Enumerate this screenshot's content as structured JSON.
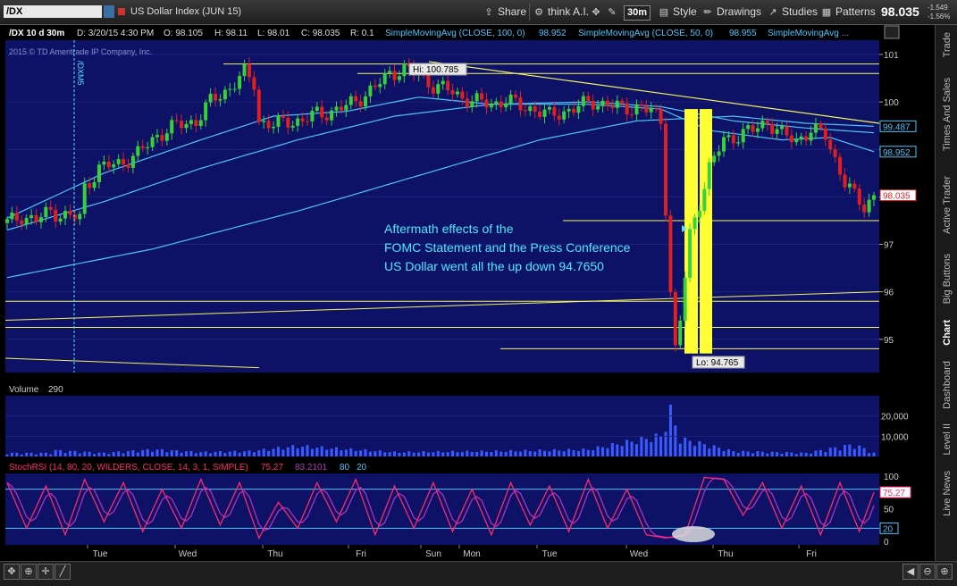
{
  "toolbar": {
    "symbol": "/DX",
    "description": "US Dollar Index (JUN 15)",
    "share": "Share",
    "think_ai": "think A.I.",
    "period": "30m",
    "style": "Style",
    "drawings": "Drawings",
    "studies": "Studies",
    "patterns": "Patterns",
    "last_price": "98.035",
    "change_abs": "-1.549",
    "change_pct": "-1.56%"
  },
  "header": {
    "symbol_period": "/DX 10 d 30m",
    "date": "D: 3/20/15 4:30 PM",
    "open": "O: 98.105",
    "high": "H: 98.11",
    "low": "L: 98.01",
    "close": "C: 98.035",
    "range": "R: 0.1",
    "sma100_label": "SimpleMovingAvg (CLOSE, 100, 0)",
    "sma100_value": "98.952",
    "sma50_label": "SimpleMovingAvg (CLOSE, 50, 0)",
    "sma50_value": "98.955",
    "sma_third_label": "SimpleMovingAvg ...",
    "copyright": "2015 © TD Ameritrade IP Company, Inc.",
    "contract_roll": "/DXM5"
  },
  "annotations": {
    "high_label": "Hi: 100.785",
    "low_label": "Lo: 94.765",
    "note_line1": "Aftermath effects of the",
    "note_line2": "FOMC Statement and the Press Conference",
    "note_line3": "US Dollar went all the up down 94.7650"
  },
  "price_badges": {
    "b1": "99.487",
    "b2": "98.952",
    "b3": "98.035"
  },
  "volume_panel": {
    "label": "Volume",
    "value": "290"
  },
  "stoch_panel": {
    "label": "StochRSI (14, 80, 20, WILDERS, CLOSE, 14, 3, 1, SIMPLE)",
    "k_value": "75.27",
    "d_value": "83.2101",
    "overbought": "80",
    "oversold": "20",
    "badge_k": "75.27",
    "badge_os": "20"
  },
  "right_tabs": [
    "Trade",
    "Times And Sales",
    "Active Trader",
    "Big Buttons",
    "Chart",
    "Dashboard",
    "Level II",
    "Live News"
  ],
  "colors": {
    "plot_bg": "#0d1266",
    "up_candle": "#39d139",
    "down_candle": "#e02020",
    "sma": "#4fc3f7",
    "trendline": "#f5f560",
    "highlight": "#ffff33",
    "note_text": "#4fe8ff",
    "volume": "#3b5bff",
    "stoch_k": "#ff2a6d",
    "stoch_d": "#b030c0"
  },
  "chart_data": {
    "type": "candlestick",
    "title": "/DX 10 d 30m",
    "x_ticks": [
      "Tue",
      "Wed",
      "Thu",
      "Fri",
      "Sun",
      "Mon",
      "Tue",
      "Wed",
      "Thu",
      "Fri"
    ],
    "y_ticks": [
      95,
      96,
      97,
      98,
      99,
      100,
      101
    ],
    "ylim": [
      94.3,
      101.3
    ],
    "volume_ticks": [
      "10,000",
      "20,000"
    ],
    "volume_ylim": [
      0,
      30000
    ],
    "stoch_ticks": [
      0,
      20,
      50,
      80,
      100
    ],
    "stoch_ylim": [
      0,
      100
    ],
    "close_path": [
      [
        0,
        97.45
      ],
      [
        3,
        97.6
      ],
      [
        6,
        97.5
      ],
      [
        9,
        97.7
      ],
      [
        12,
        97.6
      ],
      [
        15,
        97.55
      ],
      [
        16,
        98.2
      ],
      [
        19,
        98.6
      ],
      [
        23,
        98.7
      ],
      [
        27,
        98.9
      ],
      [
        31,
        99.3
      ],
      [
        35,
        99.5
      ],
      [
        39,
        99.6
      ],
      [
        42,
        100.0
      ],
      [
        46,
        100.3
      ],
      [
        49,
        100.6
      ],
      [
        51,
        100.4
      ],
      [
        52,
        99.6
      ],
      [
        55,
        99.5
      ],
      [
        58,
        99.6
      ],
      [
        61,
        99.6
      ],
      [
        64,
        99.75
      ],
      [
        67,
        99.8
      ],
      [
        70,
        99.9
      ],
      [
        73,
        100.1
      ],
      [
        76,
        100.3
      ],
      [
        79,
        100.6
      ],
      [
        82,
        100.7
      ],
      [
        85,
        100.55
      ],
      [
        88,
        100.35
      ],
      [
        91,
        100.25
      ],
      [
        94,
        100.1
      ],
      [
        97,
        100.0
      ],
      [
        100,
        99.95
      ],
      [
        103,
        100.05
      ],
      [
        106,
        99.9
      ],
      [
        109,
        99.85
      ],
      [
        112,
        99.7
      ],
      [
        115,
        99.8
      ],
      [
        118,
        99.9
      ],
      [
        121,
        100.0
      ],
      [
        124,
        99.95
      ],
      [
        127,
        99.85
      ],
      [
        130,
        99.9
      ],
      [
        133,
        99.8
      ],
      [
        135,
        99.6
      ],
      [
        137,
        96.0
      ],
      [
        138,
        94.765
      ],
      [
        139,
        95.4
      ],
      [
        141,
        97.2
      ],
      [
        143,
        97.9
      ],
      [
        145,
        98.6
      ],
      [
        148,
        99.2
      ],
      [
        151,
        99.3
      ],
      [
        154,
        99.4
      ],
      [
        157,
        99.6
      ],
      [
        160,
        99.3
      ],
      [
        163,
        99.2
      ],
      [
        166,
        99.4
      ],
      [
        169,
        99.3
      ],
      [
        171,
        98.8
      ],
      [
        173,
        98.3
      ],
      [
        175,
        98.0
      ],
      [
        177,
        97.8
      ],
      [
        179,
        98.035
      ]
    ],
    "sma_100": [
      [
        0,
        97.3
      ],
      [
        20,
        97.9
      ],
      [
        40,
        98.6
      ],
      [
        60,
        99.2
      ],
      [
        80,
        99.7
      ],
      [
        100,
        99.95
      ],
      [
        120,
        100.0
      ],
      [
        135,
        99.9
      ],
      [
        150,
        99.6
      ],
      [
        165,
        99.45
      ],
      [
        179,
        99.35
      ]
    ],
    "sma_50": [
      [
        0,
        97.55
      ],
      [
        20,
        98.5
      ],
      [
        40,
        99.2
      ],
      [
        55,
        99.7
      ],
      [
        70,
        99.8
      ],
      [
        85,
        100.1
      ],
      [
        100,
        99.95
      ],
      [
        120,
        99.95
      ],
      [
        135,
        99.85
      ],
      [
        145,
        99.4
      ],
      [
        160,
        99.2
      ],
      [
        170,
        99.25
      ],
      [
        179,
        98.952
      ]
    ],
    "sma_slow": [
      [
        0,
        96.3
      ],
      [
        30,
        96.9
      ],
      [
        60,
        97.7
      ],
      [
        90,
        98.6
      ],
      [
        110,
        99.2
      ],
      [
        130,
        99.6
      ],
      [
        150,
        99.7
      ],
      [
        165,
        99.55
      ],
      [
        179,
        99.487
      ]
    ],
    "stoch_k": [
      [
        0,
        90
      ],
      [
        4,
        20
      ],
      [
        8,
        85
      ],
      [
        12,
        10
      ],
      [
        16,
        95
      ],
      [
        20,
        30
      ],
      [
        24,
        90
      ],
      [
        28,
        15
      ],
      [
        32,
        80
      ],
      [
        36,
        20
      ],
      [
        40,
        95
      ],
      [
        44,
        25
      ],
      [
        48,
        90
      ],
      [
        52,
        5
      ],
      [
        56,
        60
      ],
      [
        60,
        20
      ],
      [
        64,
        90
      ],
      [
        68,
        30
      ],
      [
        72,
        95
      ],
      [
        76,
        10
      ],
      [
        80,
        85
      ],
      [
        84,
        20
      ],
      [
        88,
        90
      ],
      [
        92,
        15
      ],
      [
        96,
        80
      ],
      [
        100,
        10
      ],
      [
        104,
        90
      ],
      [
        108,
        25
      ],
      [
        112,
        85
      ],
      [
        116,
        15
      ],
      [
        120,
        95
      ],
      [
        124,
        20
      ],
      [
        128,
        80
      ],
      [
        132,
        10
      ],
      [
        136,
        5
      ],
      [
        140,
        10
      ],
      [
        144,
        98
      ],
      [
        148,
        95
      ],
      [
        152,
        40
      ],
      [
        156,
        90
      ],
      [
        160,
        20
      ],
      [
        164,
        85
      ],
      [
        168,
        10
      ],
      [
        172,
        90
      ],
      [
        176,
        15
      ],
      [
        179,
        75.27
      ]
    ],
    "volume_spikes": [
      [
        10,
        3500
      ],
      [
        20,
        2000
      ],
      [
        30,
        4000
      ],
      [
        40,
        2500
      ],
      [
        50,
        3000
      ],
      [
        60,
        6000
      ],
      [
        80,
        2500
      ],
      [
        100,
        3000
      ],
      [
        120,
        4000
      ],
      [
        135,
        12000
      ],
      [
        137,
        26000
      ],
      [
        138,
        18000
      ],
      [
        139,
        10000
      ],
      [
        141,
        9000
      ],
      [
        150,
        3000
      ],
      [
        165,
        2000
      ],
      [
        175,
        7000
      ],
      [
        179,
        2000
      ]
    ],
    "horizontal_levels": [
      100.8,
      100.6,
      97.5,
      95.8,
      95.25,
      94.8
    ]
  }
}
